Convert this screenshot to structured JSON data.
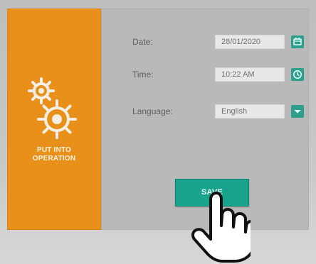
{
  "left_panel": {
    "title_line1": "PUT INTO",
    "title_line2": "OPERATION"
  },
  "form": {
    "date_label": "Date:",
    "date_value": "28/01/2020",
    "time_label": "Time:",
    "time_value": "10:22 AM",
    "language_label": "Language:",
    "language_value": "English"
  },
  "actions": {
    "save_label": "SAVE"
  },
  "colors": {
    "orange_panel": "#e8901a",
    "accent_teal": "#19a38d",
    "main_panel": "#b9b9b9"
  },
  "icons": {
    "calendar": "calendar-icon",
    "clock": "clock-icon",
    "dropdown": "chevron-down-icon",
    "gears": "gears-icon",
    "pointer": "pointing-hand-icon"
  }
}
